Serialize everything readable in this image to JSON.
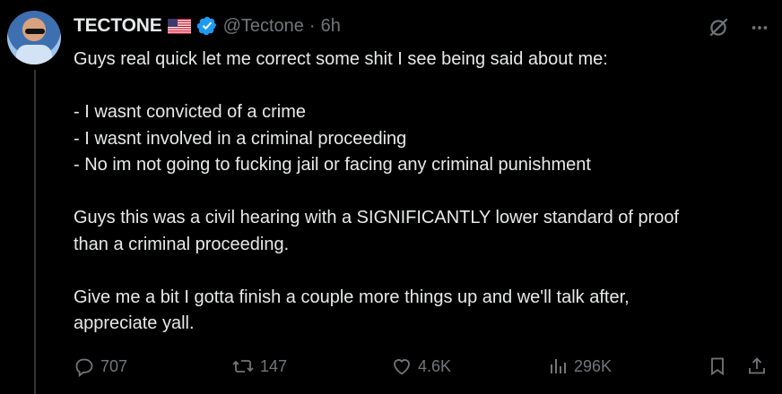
{
  "author": {
    "display_name": "TECTONE",
    "handle": "@Tectone",
    "separator": "·",
    "time": "6h",
    "flag_icon": "us-flag-icon",
    "verified_icon": "verified-badge-icon"
  },
  "tweet": {
    "lines": [
      "Guys real quick let me correct some shit I see being said about me:",
      "",
      "- I wasnt convicted of a crime",
      "- I wasnt involved in a criminal proceeding",
      "- No im not going to fucking jail or facing any criminal punishment",
      "",
      "Guys this was a civil hearing with a SIGNIFICANTLY lower standard of proof",
      "than a criminal proceeding.",
      "",
      "Give me a bit I gotta finish a couple more things up and we'll talk after,",
      "appreciate yall."
    ]
  },
  "actions": {
    "replies": "707",
    "reposts": "147",
    "likes": "4.6K",
    "views": "296K"
  },
  "colors": {
    "background": "#000000",
    "text": "#e7e9ea",
    "muted": "#71767b",
    "verified": "#1d9bf0"
  }
}
